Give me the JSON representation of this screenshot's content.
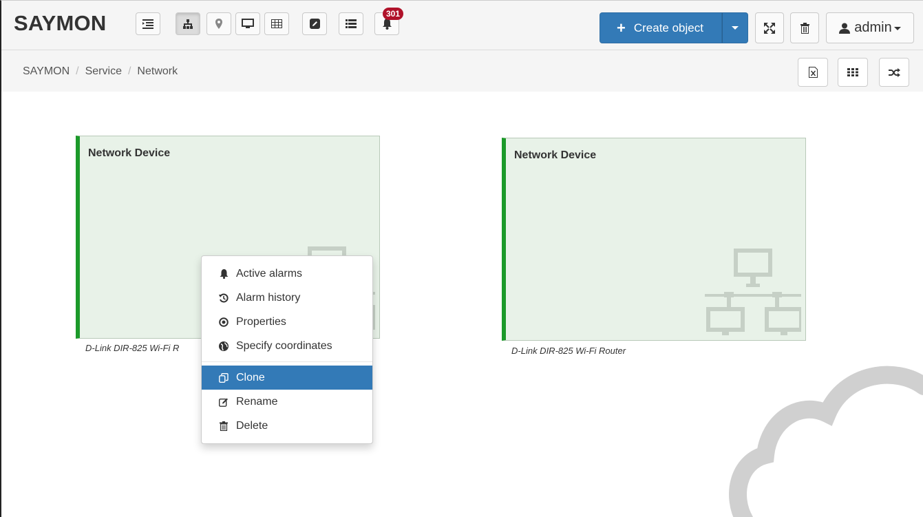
{
  "navbar": {
    "brand": "SAYMON",
    "notifications_count": "301",
    "create_label": "Create object",
    "user_label": "admin"
  },
  "toolbar_icons": [
    "list-indent-icon",
    "hierarchy-icon",
    "map-marker-icon",
    "monitor-icon",
    "table-icon",
    "edit-icon",
    "list-icon",
    "bell-icon"
  ],
  "breadcrumb": {
    "items": [
      "SAYMON",
      "Service",
      "Network"
    ],
    "separator": "/"
  },
  "content_toolbar_icons": [
    "excel-icon",
    "grid-icon",
    "shuffle-icon"
  ],
  "cards": [
    {
      "title": "Network Device",
      "caption": "D-Link DIR-825 Wi-Fi R"
    },
    {
      "title": "Network Device",
      "caption": "D-Link DIR-825 Wi-Fi Router"
    }
  ],
  "context_menu": {
    "items": [
      {
        "label": "Active alarms",
        "icon": "bell-icon"
      },
      {
        "label": "Alarm history",
        "icon": "history-icon"
      },
      {
        "label": "Properties",
        "icon": "record-icon"
      },
      {
        "label": "Specify coordinates",
        "icon": "globe-icon"
      },
      {
        "label": "Clone",
        "icon": "copy-icon",
        "highlighted": true
      },
      {
        "label": "Rename",
        "icon": "edit-icon"
      },
      {
        "label": "Delete",
        "icon": "trash-icon"
      }
    ]
  },
  "colors": {
    "primary": "#337ab7",
    "status_ok": "#1c9a2a",
    "badge": "#b0122a",
    "card_bg": "#e8f2e8"
  }
}
